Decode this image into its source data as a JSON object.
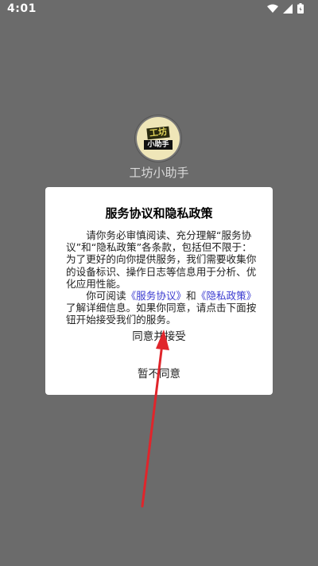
{
  "status_bar": {
    "time": "4:01"
  },
  "splash": {
    "logo_top": "工坊",
    "logo_bottom": "小助手",
    "app_name": "工坊小助手"
  },
  "dialog": {
    "title": "服务协议和隐私政策",
    "paragraph1": "请你务必审慎阅读、充分理解“服务协议”和“隐私政策”各条款，包括但不限于：为了更好的向你提供服务，我们需要收集你的设备标识、操作日志等信息用于分析、优化应用性能。",
    "paragraph2_prefix": "你可阅读",
    "link_service": "《服务协议》",
    "and_text": "和",
    "link_privacy": "《隐私政策》",
    "paragraph2_suffix": "了解详细信息。如果你同意，请点击下面按钮开始接受我们的服务。",
    "accept_label": "同意并接受",
    "decline_label": "暂不同意"
  },
  "annotation": {
    "arrow_color": "#e0252b"
  }
}
